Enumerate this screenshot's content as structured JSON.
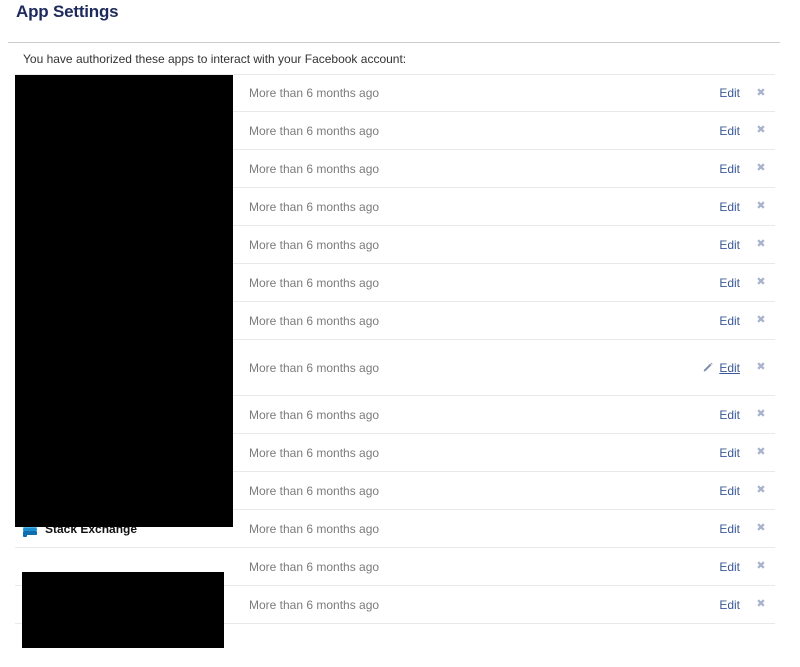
{
  "page": {
    "title": "App Settings",
    "intro": "You have authorized these apps to interact with your Facebook account:"
  },
  "colors": {
    "title": "#1d2a5b",
    "link": "#3b5998",
    "muted_text": "#7b7b7b",
    "divider": "#cccccc",
    "row_divider": "#e9e9e9",
    "remove_icon": "#a8b4cd",
    "redaction": "#000000"
  },
  "labels": {
    "edit": "Edit",
    "remove": "✖",
    "pencil_icon": "pencil-icon",
    "stack_exchange_icon": "stack-exchange-icon"
  },
  "rows": [
    {
      "name": "",
      "time": "More than 6 months ago",
      "edit": "Edit",
      "remove": "✖",
      "hovered": false,
      "has_icon": false,
      "redacted": true
    },
    {
      "name": "",
      "time": "More than 6 months ago",
      "edit": "Edit",
      "remove": "✖",
      "hovered": false,
      "has_icon": false,
      "redacted": true
    },
    {
      "name": "",
      "time": "More than 6 months ago",
      "edit": "Edit",
      "remove": "✖",
      "hovered": false,
      "has_icon": false,
      "redacted": true
    },
    {
      "name": "",
      "time": "More than 6 months ago",
      "edit": "Edit",
      "remove": "✖",
      "hovered": false,
      "has_icon": false,
      "redacted": true
    },
    {
      "name": "",
      "time": "More than 6 months ago",
      "edit": "Edit",
      "remove": "✖",
      "hovered": false,
      "has_icon": false,
      "redacted": true
    },
    {
      "name": "",
      "time": "More than 6 months ago",
      "edit": "Edit",
      "remove": "✖",
      "hovered": false,
      "has_icon": false,
      "redacted": true
    },
    {
      "name": "",
      "time": "More than 6 months ago",
      "edit": "Edit",
      "remove": "✖",
      "hovered": false,
      "has_icon": false,
      "redacted": true
    },
    {
      "name": "",
      "time": "More than 6 months ago",
      "edit": "Edit",
      "remove": "✖",
      "hovered": true,
      "has_icon": false,
      "redacted": true
    },
    {
      "name": "",
      "time": "More than 6 months ago",
      "edit": "Edit",
      "remove": "✖",
      "hovered": false,
      "has_icon": false,
      "redacted": true
    },
    {
      "name": "",
      "time": "More than 6 months ago",
      "edit": "Edit",
      "remove": "✖",
      "hovered": false,
      "has_icon": false,
      "redacted": true
    },
    {
      "name": "",
      "time": "More than 6 months ago",
      "edit": "Edit",
      "remove": "✖",
      "hovered": false,
      "has_icon": false,
      "redacted": true
    },
    {
      "name": "Stack Exchange",
      "time": "More than 6 months ago",
      "edit": "Edit",
      "remove": "✖",
      "hovered": false,
      "has_icon": true,
      "redacted": false
    },
    {
      "name": "",
      "time": "More than 6 months ago",
      "edit": "Edit",
      "remove": "✖",
      "hovered": false,
      "has_icon": false,
      "redacted": true
    },
    {
      "name": "",
      "time": "More than 6 months ago",
      "edit": "Edit",
      "remove": "✖",
      "hovered": false,
      "has_icon": false,
      "redacted": true
    }
  ]
}
